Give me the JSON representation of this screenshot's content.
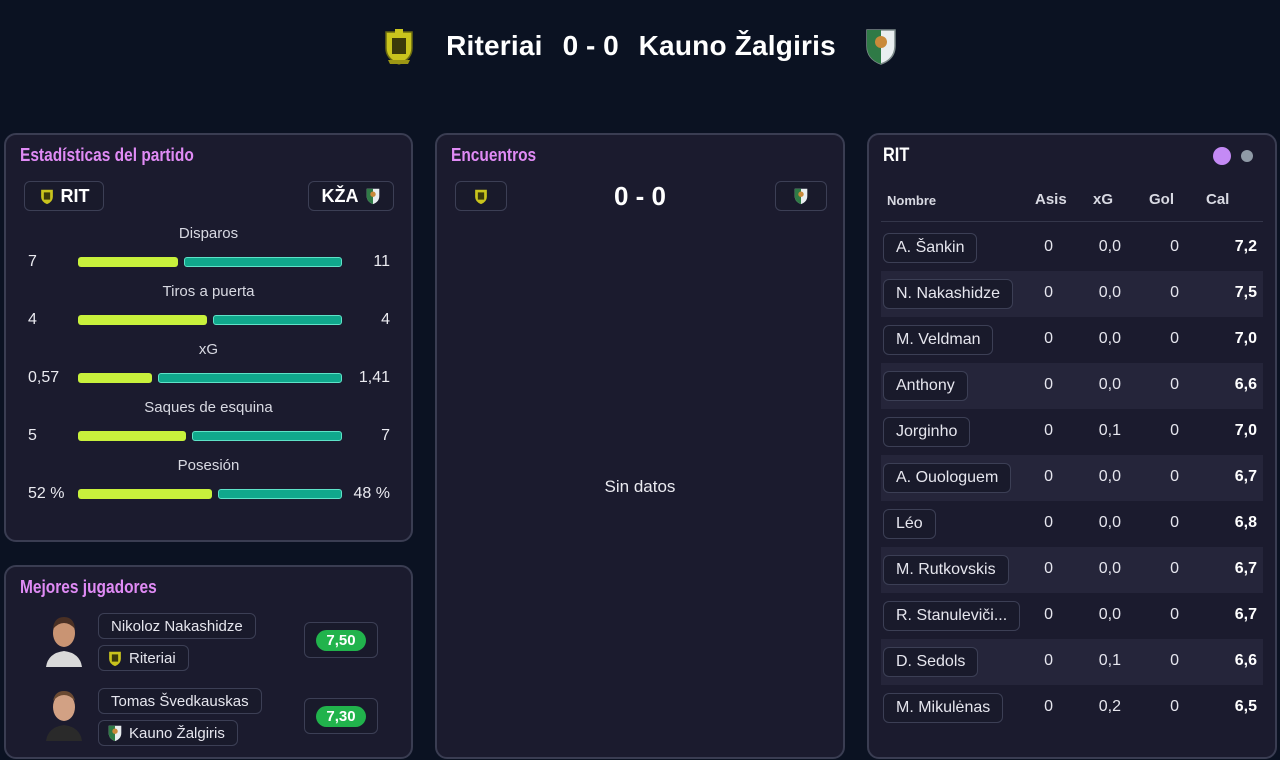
{
  "header": {
    "home_team": "Riteriai",
    "away_team": "Kauno Žalgiris",
    "score": "0 - 0"
  },
  "colors": {
    "home_bar": "#c8f13c",
    "away_bar": "#10a88c",
    "title_accent": "#e08bf5",
    "rating_green": "#21b34c"
  },
  "stats_panel": {
    "title": "Estadísticas del partido",
    "home_abbr": "RIT",
    "away_abbr": "KŽA",
    "rows": [
      {
        "label": "Disparos",
        "home": "7",
        "away": "11",
        "home_share": 0.389
      },
      {
        "label": "Tiros a puerta",
        "home": "4",
        "away": "4",
        "home_share": 0.5
      },
      {
        "label": "xG",
        "home": "0,57",
        "away": "1,41",
        "home_share": 0.288
      },
      {
        "label": "Saques de esquina",
        "home": "5",
        "away": "7",
        "home_share": 0.417
      },
      {
        "label": "Posesión",
        "home": "52 %",
        "away": "48 %",
        "home_share": 0.52
      }
    ]
  },
  "best_players": {
    "title": "Mejores jugadores",
    "players": [
      {
        "name": "Nikoloz Nakashidze",
        "team": "Riteriai",
        "rating": "7,50"
      },
      {
        "name": "Tomas Švedkauskas",
        "team": "Kauno Žalgiris",
        "rating": "7,30"
      }
    ]
  },
  "encounters": {
    "title": "Encuentros",
    "score": "0 - 0",
    "empty": "Sin datos"
  },
  "player_table": {
    "team": "RIT",
    "columns": {
      "name": "Nombre",
      "assists": "Asis",
      "xg": "xG",
      "goals": "Gol",
      "rating": "Cal"
    },
    "rows": [
      {
        "name": "A. Šankin",
        "assists": "0",
        "xg": "0,0",
        "goals": "0",
        "rating": "7,2"
      },
      {
        "name": "N. Nakashidze",
        "assists": "0",
        "xg": "0,0",
        "goals": "0",
        "rating": "7,5"
      },
      {
        "name": "M. Veldman",
        "assists": "0",
        "xg": "0,0",
        "goals": "0",
        "rating": "7,0"
      },
      {
        "name": "Anthony",
        "assists": "0",
        "xg": "0,0",
        "goals": "0",
        "rating": "6,6"
      },
      {
        "name": "Jorginho",
        "assists": "0",
        "xg": "0,1",
        "goals": "0",
        "rating": "7,0"
      },
      {
        "name": "A. Ouologuem",
        "assists": "0",
        "xg": "0,0",
        "goals": "0",
        "rating": "6,7"
      },
      {
        "name": "Léo",
        "assists": "0",
        "xg": "0,0",
        "goals": "0",
        "rating": "6,8"
      },
      {
        "name": "M. Rutkovskis",
        "assists": "0",
        "xg": "0,0",
        "goals": "0",
        "rating": "6,7"
      },
      {
        "name": "R. Stanuleviči...",
        "assists": "0",
        "xg": "0,0",
        "goals": "0",
        "rating": "6,7"
      },
      {
        "name": "D. Sedols",
        "assists": "0",
        "xg": "0,1",
        "goals": "0",
        "rating": "6,6"
      },
      {
        "name": "M. Mikulėnas",
        "assists": "0",
        "xg": "0,2",
        "goals": "0",
        "rating": "6,5"
      }
    ]
  }
}
